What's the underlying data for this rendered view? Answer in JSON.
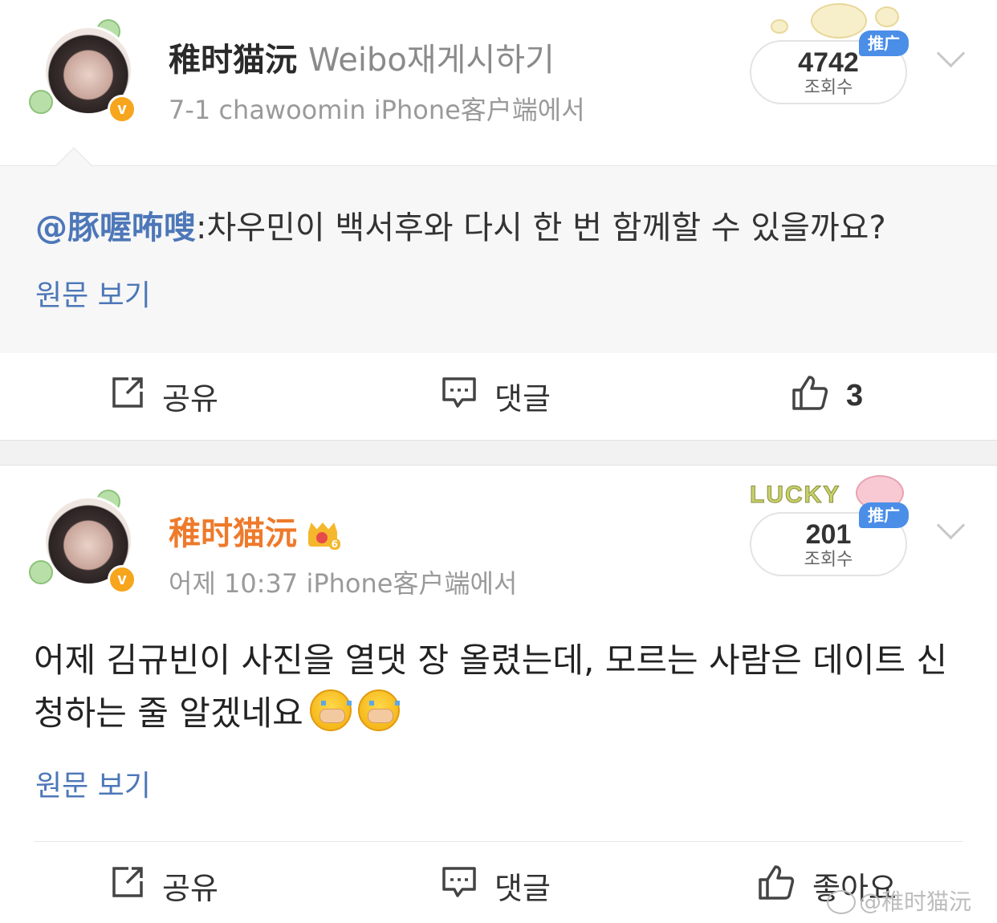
{
  "posts": [
    {
      "username": "稚时猫沅",
      "repost_label": "Weibo재게시하기",
      "meta": "7-1  chawoomin iPhone客户端에서",
      "views": "4742",
      "views_label": "조회수",
      "promo_label": "推广",
      "quote": {
        "mention": "@豚喔咘嗖",
        "text": ":차우민이 백서후와 다시 한 번 함께할 수 있을까요?"
      },
      "view_original": "원문 보기",
      "actions": {
        "share": "공유",
        "comment": "댓글",
        "like": "3"
      }
    },
    {
      "username": "稚时猫沅",
      "meta": "어제 10:37  iPhone客户端에서",
      "views": "201",
      "views_label": "조회수",
      "promo_label": "推广",
      "sticker_text": "LUCKY",
      "body": "어제 김규빈이 사진을 열댓 장 올렸는데, 모르는 사람은 데이트 신청하는 줄 알겠네요",
      "view_original": "원문 보기",
      "actions": {
        "share": "공유",
        "comment": "댓글",
        "like": "좋아요"
      }
    }
  ],
  "watermark": "@稚时猫沅",
  "colors": {
    "link": "#4d77b8",
    "vip_name": "#ee7a2b",
    "verified": "#f7a51c",
    "promo": "#4a8ee8"
  },
  "icons": [
    "share-icon",
    "comment-icon",
    "thumbs-up-icon",
    "chevron-down-icon",
    "verified-badge-icon",
    "crown-icon",
    "crying-emoji-icon",
    "weibo-logo-icon"
  ]
}
